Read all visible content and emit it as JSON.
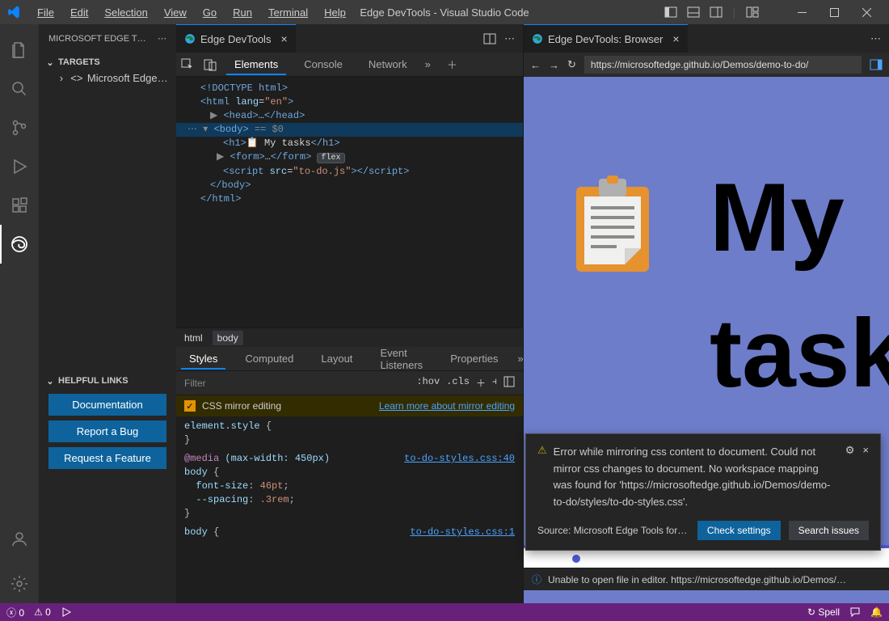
{
  "menu": {
    "file": "File",
    "edit": "Edit",
    "selection": "Selection",
    "view": "View",
    "go": "Go",
    "run": "Run",
    "terminal": "Terminal",
    "help": "Help"
  },
  "app_title": "Edge DevTools - Visual Studio Code",
  "sidebar": {
    "header": "MICROSOFT EDGE T…",
    "targets": "TARGETS",
    "target_item": "Microsoft Edge …",
    "helpful": "HELPFUL LINKS",
    "docs": "Documentation",
    "bug": "Report a Bug",
    "feature": "Request a Feature"
  },
  "tabs": {
    "devtools": "Edge DevTools",
    "browser": "Edge DevTools: Browser"
  },
  "dt_tabs": {
    "elements": "Elements",
    "console": "Console",
    "network": "Network"
  },
  "dom": {
    "doctype": "<!DOCTYPE html>",
    "html_open": "<html lang=\"en\">",
    "head": "<head>…</head>",
    "body_open": "<body>",
    "body_eq": " == $0",
    "h1_pre": "<h1>",
    "h1_emoji": "📋",
    "h1_text": " My tasks",
    "h1_close": "</h1>",
    "form": "<form>…</form>",
    "flex": "flex",
    "script": "<script src=\"to-do.js\"></scr",
    "script_end": "ipt>",
    "body_close": "</body>",
    "html_close": "</html>"
  },
  "crumbs": {
    "html": "html",
    "body": "body"
  },
  "style_tabs": {
    "styles": "Styles",
    "computed": "Computed",
    "layout": "Layout",
    "listeners": "Event Listeners",
    "properties": "Properties"
  },
  "filter": {
    "placeholder": "Filter",
    "hov": ":hov",
    "cls": ".cls"
  },
  "mirror": {
    "label": "CSS mirror editing",
    "link": "Learn more about mirror editing"
  },
  "css": {
    "el": "element.style {",
    "media": "@media (max-width: 450px)",
    "body": "body {",
    "fs": "  font-size: 46pt;",
    "sp": "  --spacing: .3rem;",
    "close": "}",
    "link1": "to-do-styles.css:40",
    "link2": "to-do-styles.css:1",
    "body2": "body {"
  },
  "browser": {
    "url": "https://microsoftedge.github.io/Demos/demo-to-do/"
  },
  "page": {
    "heading": "My tasks"
  },
  "toast": {
    "msg": "Error while mirroring css content to document. Could not mirror css changes to document. No workspace mapping was found for 'https://microsoftedge.github.io/Demos/demo-to-do/styles/to-do-styles.css'.",
    "source": "Source: Microsoft Edge Tools for VS Code…",
    "check": "Check settings",
    "search": "Search issues"
  },
  "info": "Unable to open file in editor. https://microsoftedge.github.io/Demos/…",
  "status": {
    "errors": "0",
    "warnings": "0",
    "spell": "Spell"
  }
}
